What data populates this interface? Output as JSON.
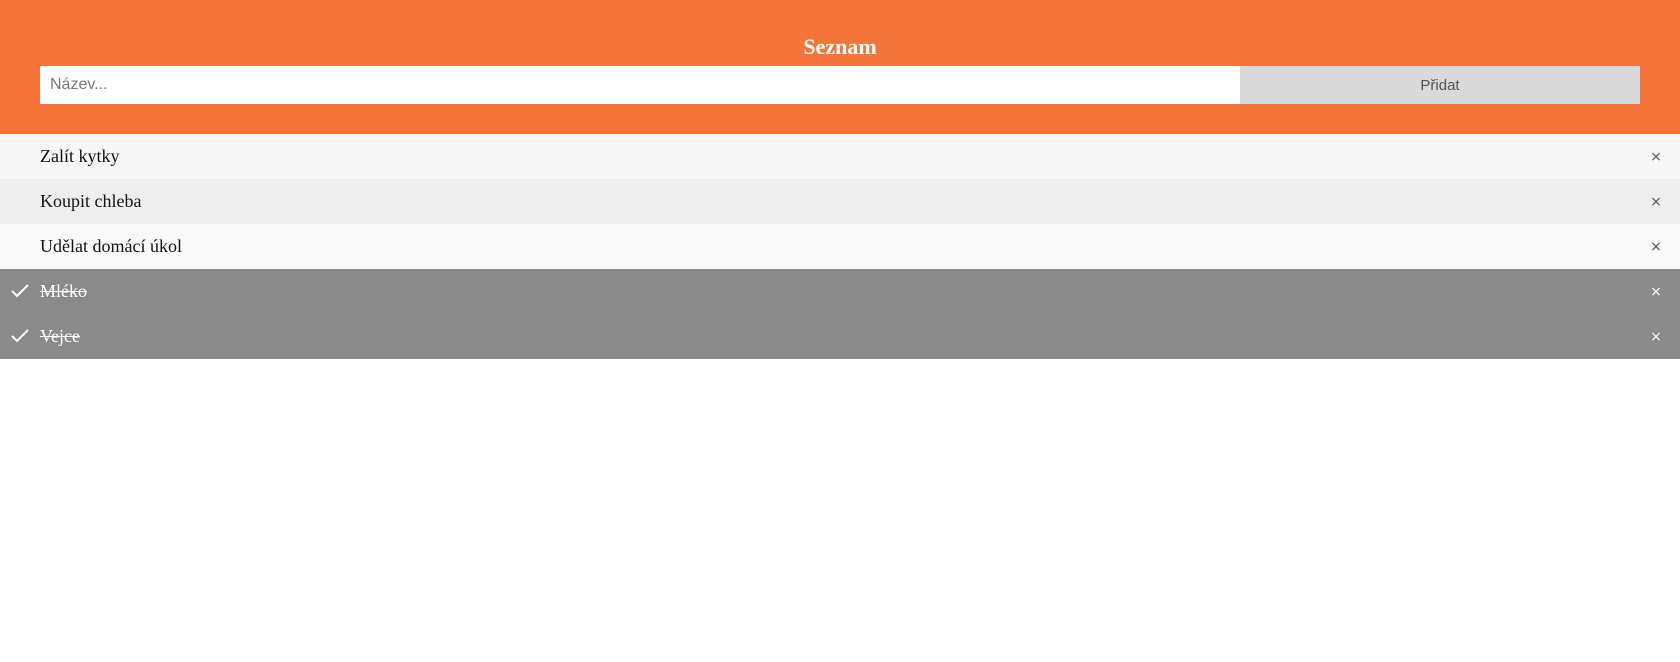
{
  "header": {
    "title": "Seznam",
    "input_placeholder": "Název...",
    "add_label": "Přidat"
  },
  "items": [
    {
      "text": "Zalít kytky",
      "done": false
    },
    {
      "text": "Koupit chleba",
      "done": false
    },
    {
      "text": "Udělat domácí úkol",
      "done": false
    },
    {
      "text": "Mléko",
      "done": true
    },
    {
      "text": "Vejce",
      "done": true
    }
  ],
  "icons": {
    "check": "check-icon",
    "close": "close-icon",
    "close_glyph": "×"
  },
  "colors": {
    "header_bg": "#f4743a",
    "done_bg": "#8a8a8a"
  }
}
